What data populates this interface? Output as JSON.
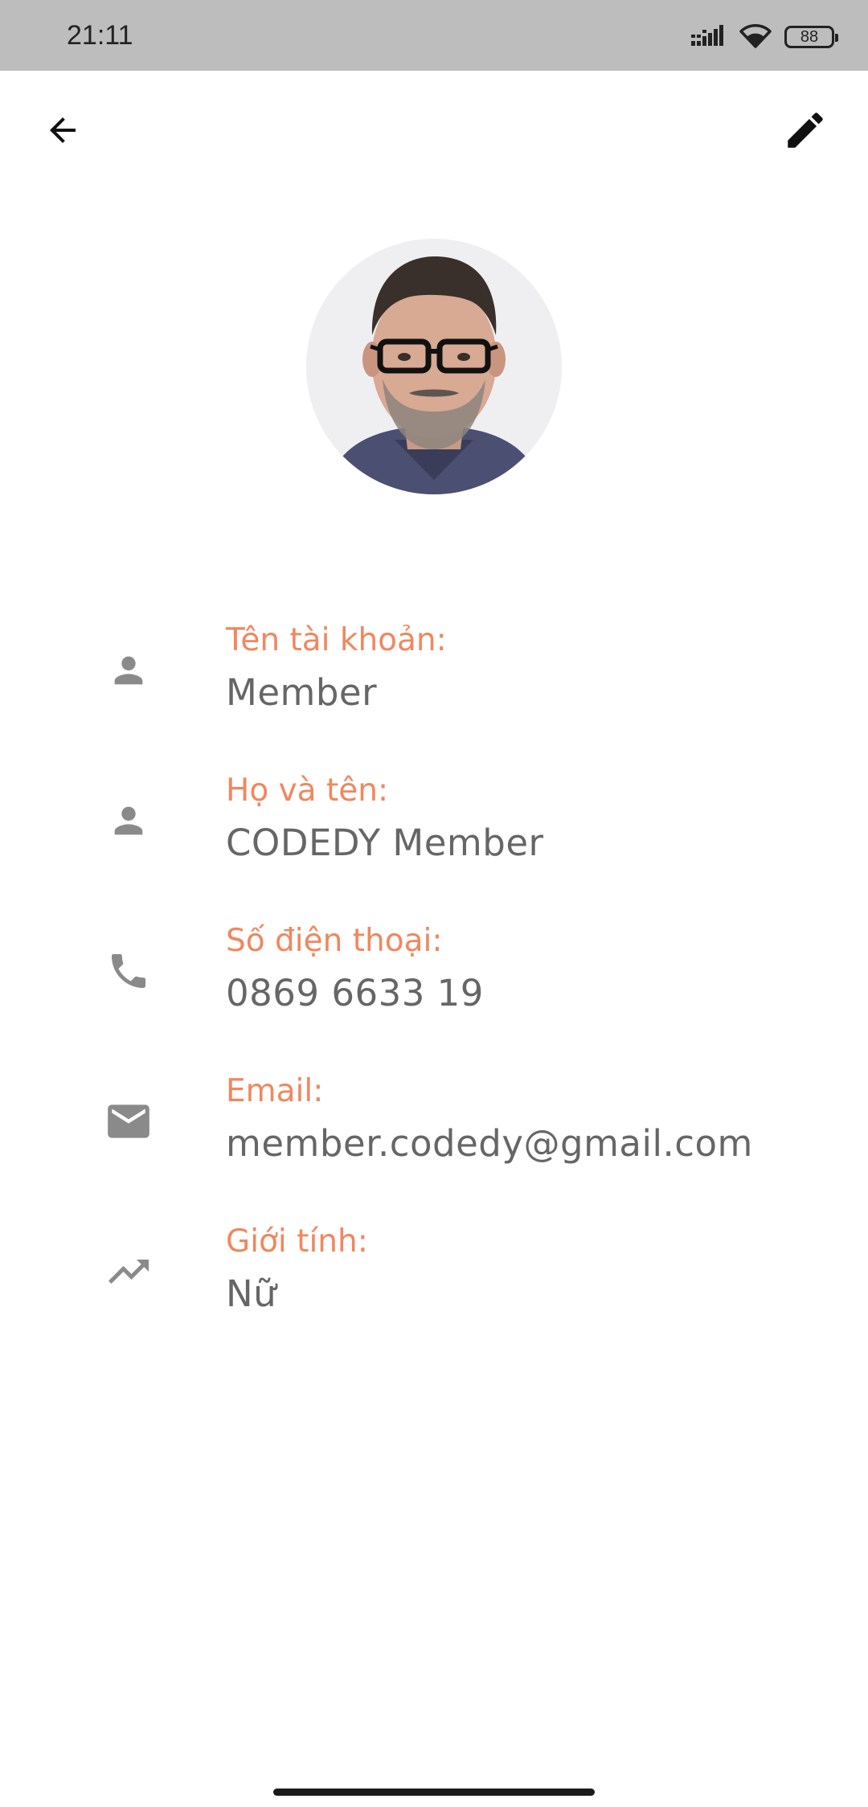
{
  "status_bar": {
    "time": "21:11",
    "battery": "88",
    "icons": [
      "signal-icon",
      "wifi-icon",
      "battery-icon"
    ]
  },
  "app_bar": {
    "back_icon": "arrow-back-icon",
    "edit_icon": "pencil-icon"
  },
  "profile": {
    "fields": [
      {
        "icon": "person-icon",
        "label": "Tên tài khoản:",
        "value": "Member"
      },
      {
        "icon": "person-icon",
        "label": "Họ và tên:",
        "value": "CODEDY Member"
      },
      {
        "icon": "phone-icon",
        "label": "Số điện thoại:",
        "value": "0869 6633 19"
      },
      {
        "icon": "email-icon",
        "label": "Email:",
        "value": "member.codedy@gmail.com"
      },
      {
        "icon": "trending-up-icon",
        "label": "Giới tính:",
        "value": "Nữ"
      }
    ]
  },
  "colors": {
    "label": "#f0875f",
    "value": "#666666",
    "icon": "#8a8a8a",
    "status_bar": "#bdbdbd"
  }
}
